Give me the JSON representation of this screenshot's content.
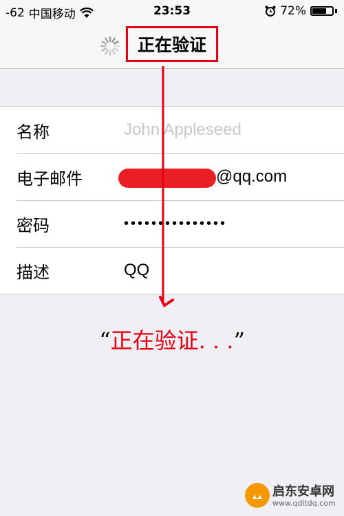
{
  "status_bar": {
    "signal": "-62",
    "carrier": "中国移动",
    "time": "23:53",
    "battery": "72%",
    "battery_level": 0.72,
    "icons": [
      "wifi-icon",
      "alarm-icon",
      "battery-icon"
    ]
  },
  "nav": {
    "title": "正在验证",
    "spinner_icon": "activity-spinner-icon"
  },
  "form": {
    "rows": [
      {
        "label": "名称",
        "value": "John Appleseed",
        "is_placeholder": true
      },
      {
        "label": "电子邮件",
        "value": "@qq.com"
      },
      {
        "label": "密码",
        "value": "•••••••••••••••"
      },
      {
        "label": "描述",
        "value": "QQ"
      }
    ]
  },
  "annotation": {
    "open_quote": "“",
    "text": "正在验证. . .",
    "close_quote": "”",
    "color": "#e60012"
  },
  "watermark": {
    "title": "启东安卓网",
    "url": "www.qdltdq.com"
  }
}
